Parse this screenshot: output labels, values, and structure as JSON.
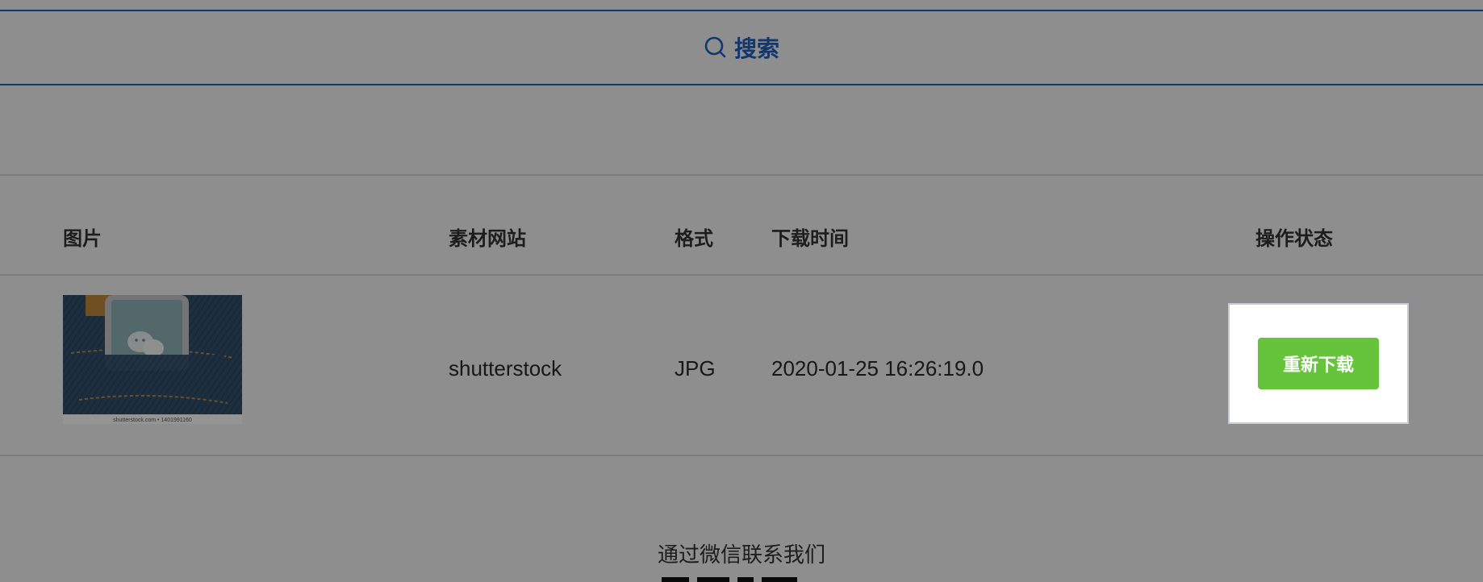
{
  "search": {
    "label": "搜索",
    "icon": "search-icon"
  },
  "table": {
    "headers": {
      "image": "图片",
      "site": "素材网站",
      "format": "格式",
      "download_time": "下载时间",
      "status": "操作状态"
    },
    "rows": [
      {
        "site": "shutterstock",
        "format": "JPG",
        "download_time": "2020-01-25 16:26:19.0",
        "thumbnail_caption": "shutterstock.com • 1401991160",
        "action_label": "重新下载"
      }
    ]
  },
  "footer": {
    "contact_text": "通过微信联系我们"
  },
  "colors": {
    "accent": "#1f5fbf",
    "button_green": "#66c43c"
  }
}
